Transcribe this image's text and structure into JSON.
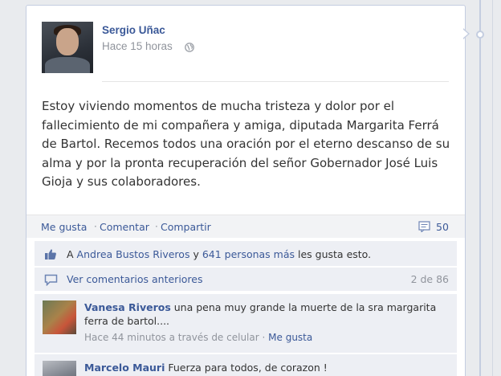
{
  "post": {
    "author": "Sergio Uñac",
    "time": "Hace 15 horas",
    "privacy_icon": "globe-icon",
    "text": "Estoy viviendo momentos de mucha tristeza y dolor por el fallecimiento de mi compañera y amiga, diputada Margarita Ferrá de Bartol. Recemos todos una oración por el eterno descanso de su alma y por la pronta recuperación del señor Gobernador José Luis Gioja y sus colaboradores."
  },
  "actions": {
    "like": "Me gusta",
    "comment": "Comentar",
    "share": "Compartir",
    "separator": "·",
    "comment_count": "50"
  },
  "likes": {
    "prefix": "A",
    "person": "Andrea Bustos Riveros",
    "conj": "y",
    "others": "641 personas más",
    "suffix": "les gusta esto."
  },
  "more_comments": {
    "label": "Ver comentarios anteriores",
    "count": "2 de 86"
  },
  "comments": [
    {
      "name": "Vanesa Riveros",
      "text": "una pena muy grande la muerte de la sra margarita ferra de bartol....",
      "meta": "Hace 44 minutos a través de celular",
      "like": "Me gusta",
      "separator": "·"
    },
    {
      "name": "Marcelo Mauri",
      "text": "Fuerza para todos, de corazon !"
    }
  ],
  "colors": {
    "link": "#3b5998",
    "muted": "#90949c",
    "row_bg": "#edeff4"
  }
}
